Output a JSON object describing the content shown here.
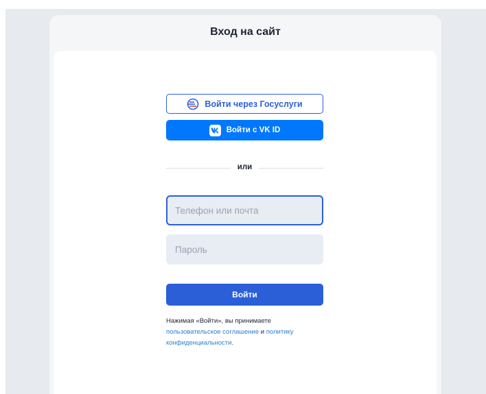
{
  "modal": {
    "title": "Вход на сайт"
  },
  "social": {
    "gosuslugi_label": "Войти через Госуслуги",
    "vk_label": "Войти с VK ID"
  },
  "divider": {
    "text": "или"
  },
  "form": {
    "login_value": "",
    "login_placeholder": "Телефон или почта",
    "password_value": "",
    "password_placeholder": "Пароль",
    "submit_label": "Войти"
  },
  "terms": {
    "prefix": "Нажимая «Войти», вы принимаете",
    "agreement_link": "пользовательское соглашение",
    "and_text": " и ",
    "policy_link": "политику",
    "privacy_link": "конфиденциальности",
    "suffix": "."
  },
  "colors": {
    "accent": "#2b5fd8",
    "vk_blue": "#0077ff",
    "link": "#2b7fd0",
    "field_bg": "#e8ecf3",
    "page_bg": "#e7ebef"
  },
  "icons": {
    "gosuslugi": "gosuslugi-logo-icon",
    "vk": "vk-logo-icon"
  }
}
